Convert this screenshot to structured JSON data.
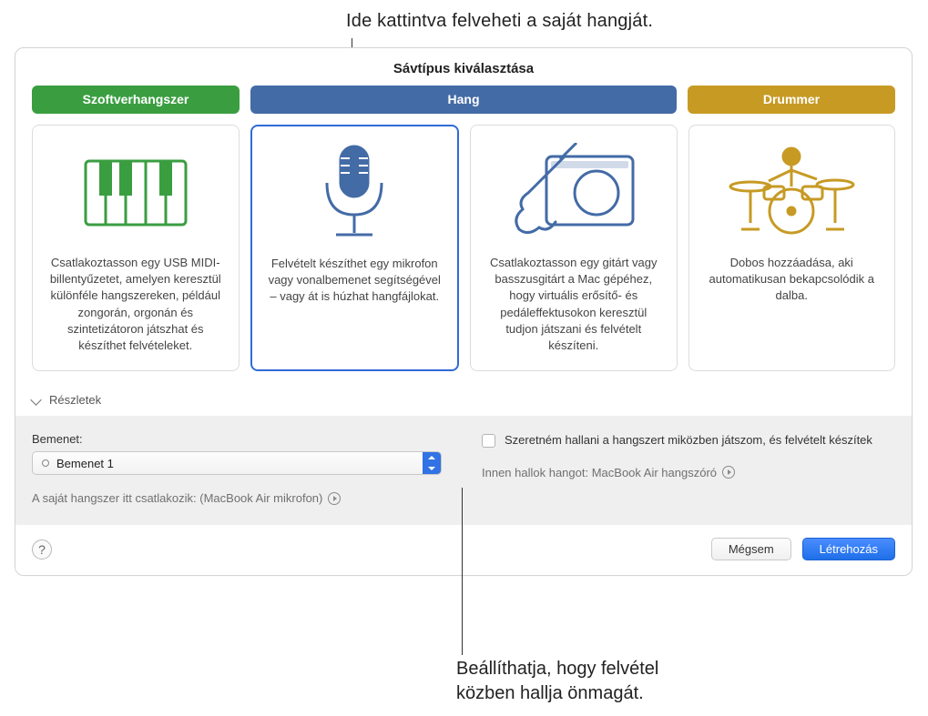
{
  "callouts": {
    "top": "Ide kattintva felveheti a saját hangját.",
    "bottom_line1": "Beállíthatja, hogy felvétel",
    "bottom_line2": "közben hallja önmagát."
  },
  "window": {
    "title": "Sávtípus kiválasztása",
    "tabs": {
      "software": "Szoftverhangszer",
      "audio": "Hang",
      "drummer": "Drummer"
    },
    "cards": {
      "software": "Csatlakoztasson egy USB MIDI-billentyűzetet, amelyen keresztül különféle hangszereken, például zongorán, orgonán és szintetizátoron játszhat és készíthet felvételeket.",
      "mic": "Felvételt készíthet egy mikrofon vagy vonalbemenet segítségével – vagy át is húzhat hangfájlokat.",
      "guitar": "Csatlakoztasson egy gitárt vagy basszusgitárt a Mac gépéhez, hogy virtuális erősítő- és pedáleffektusokon keresztül tudjon játszani és felvételt készíteni.",
      "drummer": "Dobos hozzáadása, aki automatikusan bekapcsolódik a dalba."
    },
    "details_label": "Részletek",
    "input": {
      "label": "Bemenet:",
      "value": "Bemenet 1",
      "hint_prefix": "A saját hangszer itt csatlakozik: ",
      "hint_value": "(MacBook Air mikrofon)"
    },
    "monitor": {
      "checkbox_label": "Szeretném hallani a hangszert miközben játszom, és felvételt készítek",
      "hint_prefix": "Innen hallok hangot: ",
      "hint_value": "MacBook Air hangszóró"
    },
    "footer": {
      "help": "?",
      "cancel": "Mégsem",
      "create": "Létrehozás"
    }
  }
}
